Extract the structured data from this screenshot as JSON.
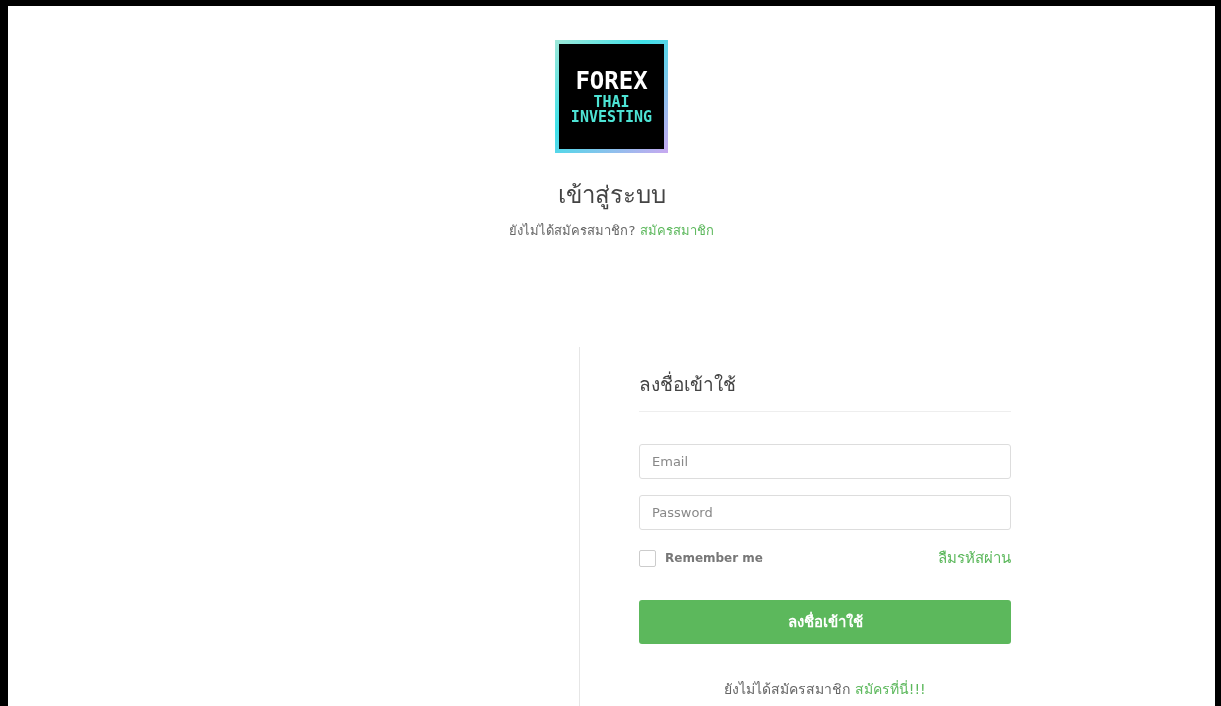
{
  "logo": {
    "lines": [
      "FOREX",
      "THAI",
      "INVESTING"
    ]
  },
  "header": {
    "title": "เข้าสู่ระบบ",
    "prompt": "ยังไม่ได้สมัครสมาชิก?",
    "link": "สมัครสมาชิก"
  },
  "login_form": {
    "heading": "ลงชื่อเข้าใช้",
    "fields": [
      {
        "placeholder": "Email"
      },
      {
        "placeholder": "Password"
      }
    ],
    "remember": {
      "label": "Remember me",
      "checked": false
    },
    "forgot_link": "ลืมรหัสผ่าน",
    "submit": "ลงชื่อเข้าใช้",
    "footer": {
      "prompt": "ยังไม่ได้สมัครสมาชิก",
      "link": "สมัครที่นี่!!!"
    }
  }
}
